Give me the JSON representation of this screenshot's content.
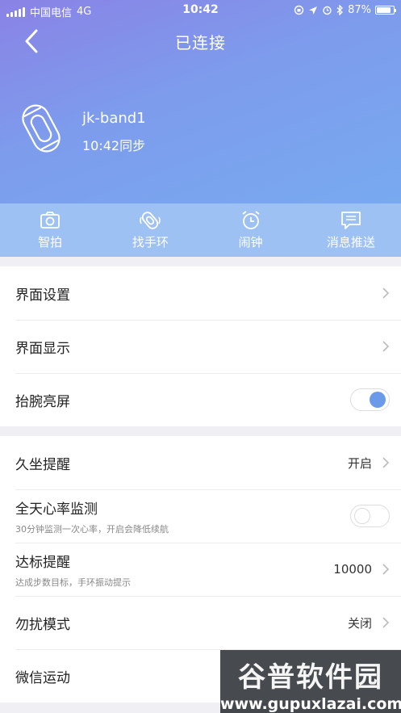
{
  "status_bar": {
    "carrier": "中国电信",
    "network": "4G",
    "time": "10:42",
    "battery": "87%"
  },
  "nav": {
    "title": "已连接"
  },
  "device": {
    "name": "jk-band1",
    "sync_text": "10:42同步"
  },
  "quick_actions": [
    {
      "label": "智拍",
      "icon": "camera-icon"
    },
    {
      "label": "找手环",
      "icon": "find-band-icon"
    },
    {
      "label": "闹钟",
      "icon": "alarm-clock-icon"
    },
    {
      "label": "消息推送",
      "icon": "message-icon"
    }
  ],
  "settings_group_1": [
    {
      "label": "界面设置"
    },
    {
      "label": "界面显示"
    },
    {
      "label": "抬腕亮屏",
      "toggle": true
    }
  ],
  "settings_group_2": [
    {
      "label": "久坐提醒",
      "value": "开启"
    },
    {
      "label": "全天心率监测",
      "sub": "30分钟监测一次心率，开启会降低续航",
      "toggle": false
    },
    {
      "label": "达标提醒",
      "sub": "达成步数目标，手环振动提示",
      "value": "10000"
    },
    {
      "label": "勿扰模式",
      "value": "关闭"
    },
    {
      "label": "微信运动"
    }
  ],
  "watermark": {
    "title": "谷普软件园",
    "url": "www.gupuxlazai.com"
  },
  "colors": {
    "header_start": "#8a82e6",
    "header_end": "#78aaf0",
    "quick_bar": "#9ec1f3",
    "toggle_on": "#6b9ae8"
  }
}
